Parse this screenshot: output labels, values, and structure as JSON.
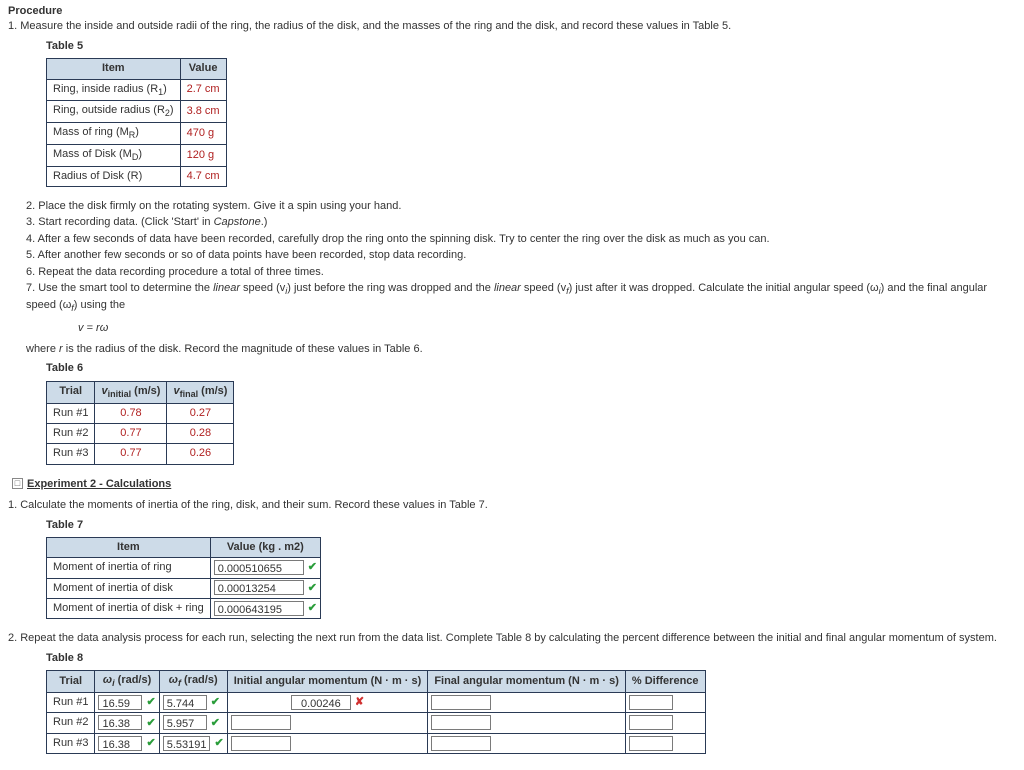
{
  "procedure_title": "Procedure",
  "step1": "1. Measure the inside and outside radii of the ring, the radius of the disk, and the masses of the ring and the disk, and record these values in Table 5.",
  "table5_label": "Table 5",
  "table5_h_item": "Item",
  "table5_h_value": "Value",
  "table5": {
    "row1_item": "Ring, inside radius (R",
    "row1_sub": "1",
    "row1_item_end": ")",
    "row1_val": "2.7 cm",
    "row2_item": "Ring, outside radius (R",
    "row2_sub": "2",
    "row2_item_end": ")",
    "row2_val": "3.8 cm",
    "row3_item": "Mass of ring (M",
    "row3_sub": "R",
    "row3_item_end": ")",
    "row3_val": "470 g",
    "row4_item": "Mass of Disk (M",
    "row4_sub": "D",
    "row4_item_end": ")",
    "row4_val": "120 g",
    "row5_item": "Radius of Disk (R)",
    "row5_val": "4.7 cm"
  },
  "step2": "2. Place the disk firmly on the rotating system. Give it a spin using your hand.",
  "step3a": "3. Start recording data. (Click 'Start' in ",
  "step3b": "Capstone",
  "step3c": ".)",
  "step4": "4. After a few seconds of data have been recorded, carefully drop the ring onto the spinning disk. Try to center the ring over the disk as much as you can.",
  "step5": "5. After another few seconds or so of data points have been recorded, stop data recording.",
  "step6": "6. Repeat the data recording procedure a total of three times.",
  "step7a": "7. Use the smart tool to determine the ",
  "step7_linear1": "linear",
  "step7b": " speed  (v",
  "step7_sub_i": "i",
  "step7c": ")  just before the ring was dropped and the ",
  "step7_linear2": "linear",
  "step7d": " speed  (v",
  "step7_sub_f": "f",
  "step7e": ")  just after it was dropped. Calculate the initial angular speed  (ω",
  "step7_sub_i2": "i",
  "step7f": ")  and the final angular speed  (ω",
  "step7_sub_f2": "f",
  "step7g": ")  using the",
  "equation": "v = rω",
  "eq_footer": "where r is the radius of the disk. Record the magnitude of these values in Table 6.",
  "table6_label": "Table 6",
  "table6_h_trial": "Trial",
  "table6_h_vi1": "v",
  "table6_h_vi2": "initial",
  "table6_h_vi3": " (m/s)",
  "table6_h_vf1": "v",
  "table6_h_vf2": "final",
  "table6_h_vf3": " (m/s)",
  "table6": {
    "r1_t": "Run #1",
    "r1_vi": "0.78",
    "r1_vf": "0.27",
    "r2_t": "Run #2",
    "r2_vi": "0.77",
    "r2_vf": "0.28",
    "r3_t": "Run #3",
    "r3_vi": "0.77",
    "r3_vf": "0.26"
  },
  "exp2_header": "Experiment 2 - Calculations",
  "exp2_step1": "1. Calculate the moments of inertia of the ring, disk, and their sum. Record these values in Table 7.",
  "table7_label": "Table 7",
  "table7_h_item": "Item",
  "table7_h_val": "Value (kg . m2)",
  "table7": {
    "r1_item": "Moment of inertia of ring",
    "r1_val": "0.000510655",
    "r2_item": "Moment of inertia of disk",
    "r2_val": "0.00013254",
    "r3_item": "Moment of inertia of disk + ring",
    "r3_val": "0.000643195"
  },
  "exp2_step2": "2. Repeat the data analysis process for each run, selecting the next run from the data list. Complete Table 8 by calculating the percent difference between the initial and final angular momentum of system.",
  "table8_label": "Table 8",
  "table8_h_trial": "Trial",
  "table8_h_wi_a": "ω",
  "table8_h_wi_b": "i",
  "table8_h_wi_c": " (rad/s)",
  "table8_h_wf_a": "ω",
  "table8_h_wf_b": "f",
  "table8_h_wf_c": " (rad/s)",
  "table8_h_iam": "Initial angular momentum (N · m · s)",
  "table8_h_fam": "Final angular momentum (N · m · s)",
  "table8_h_diff": "% Difference",
  "table8": {
    "r1_t": "Run #1",
    "r1_wi": "16.59",
    "r1_wf": "5.744",
    "r1_iam": "0.00246",
    "r2_t": "Run #2",
    "r2_wi": "16.38",
    "r2_wf": "5.957",
    "r3_t": "Run #3",
    "r3_wi": "16.38",
    "r3_wf": "5.53191"
  },
  "marks": {
    "check": "✔",
    "cross": "✘"
  }
}
